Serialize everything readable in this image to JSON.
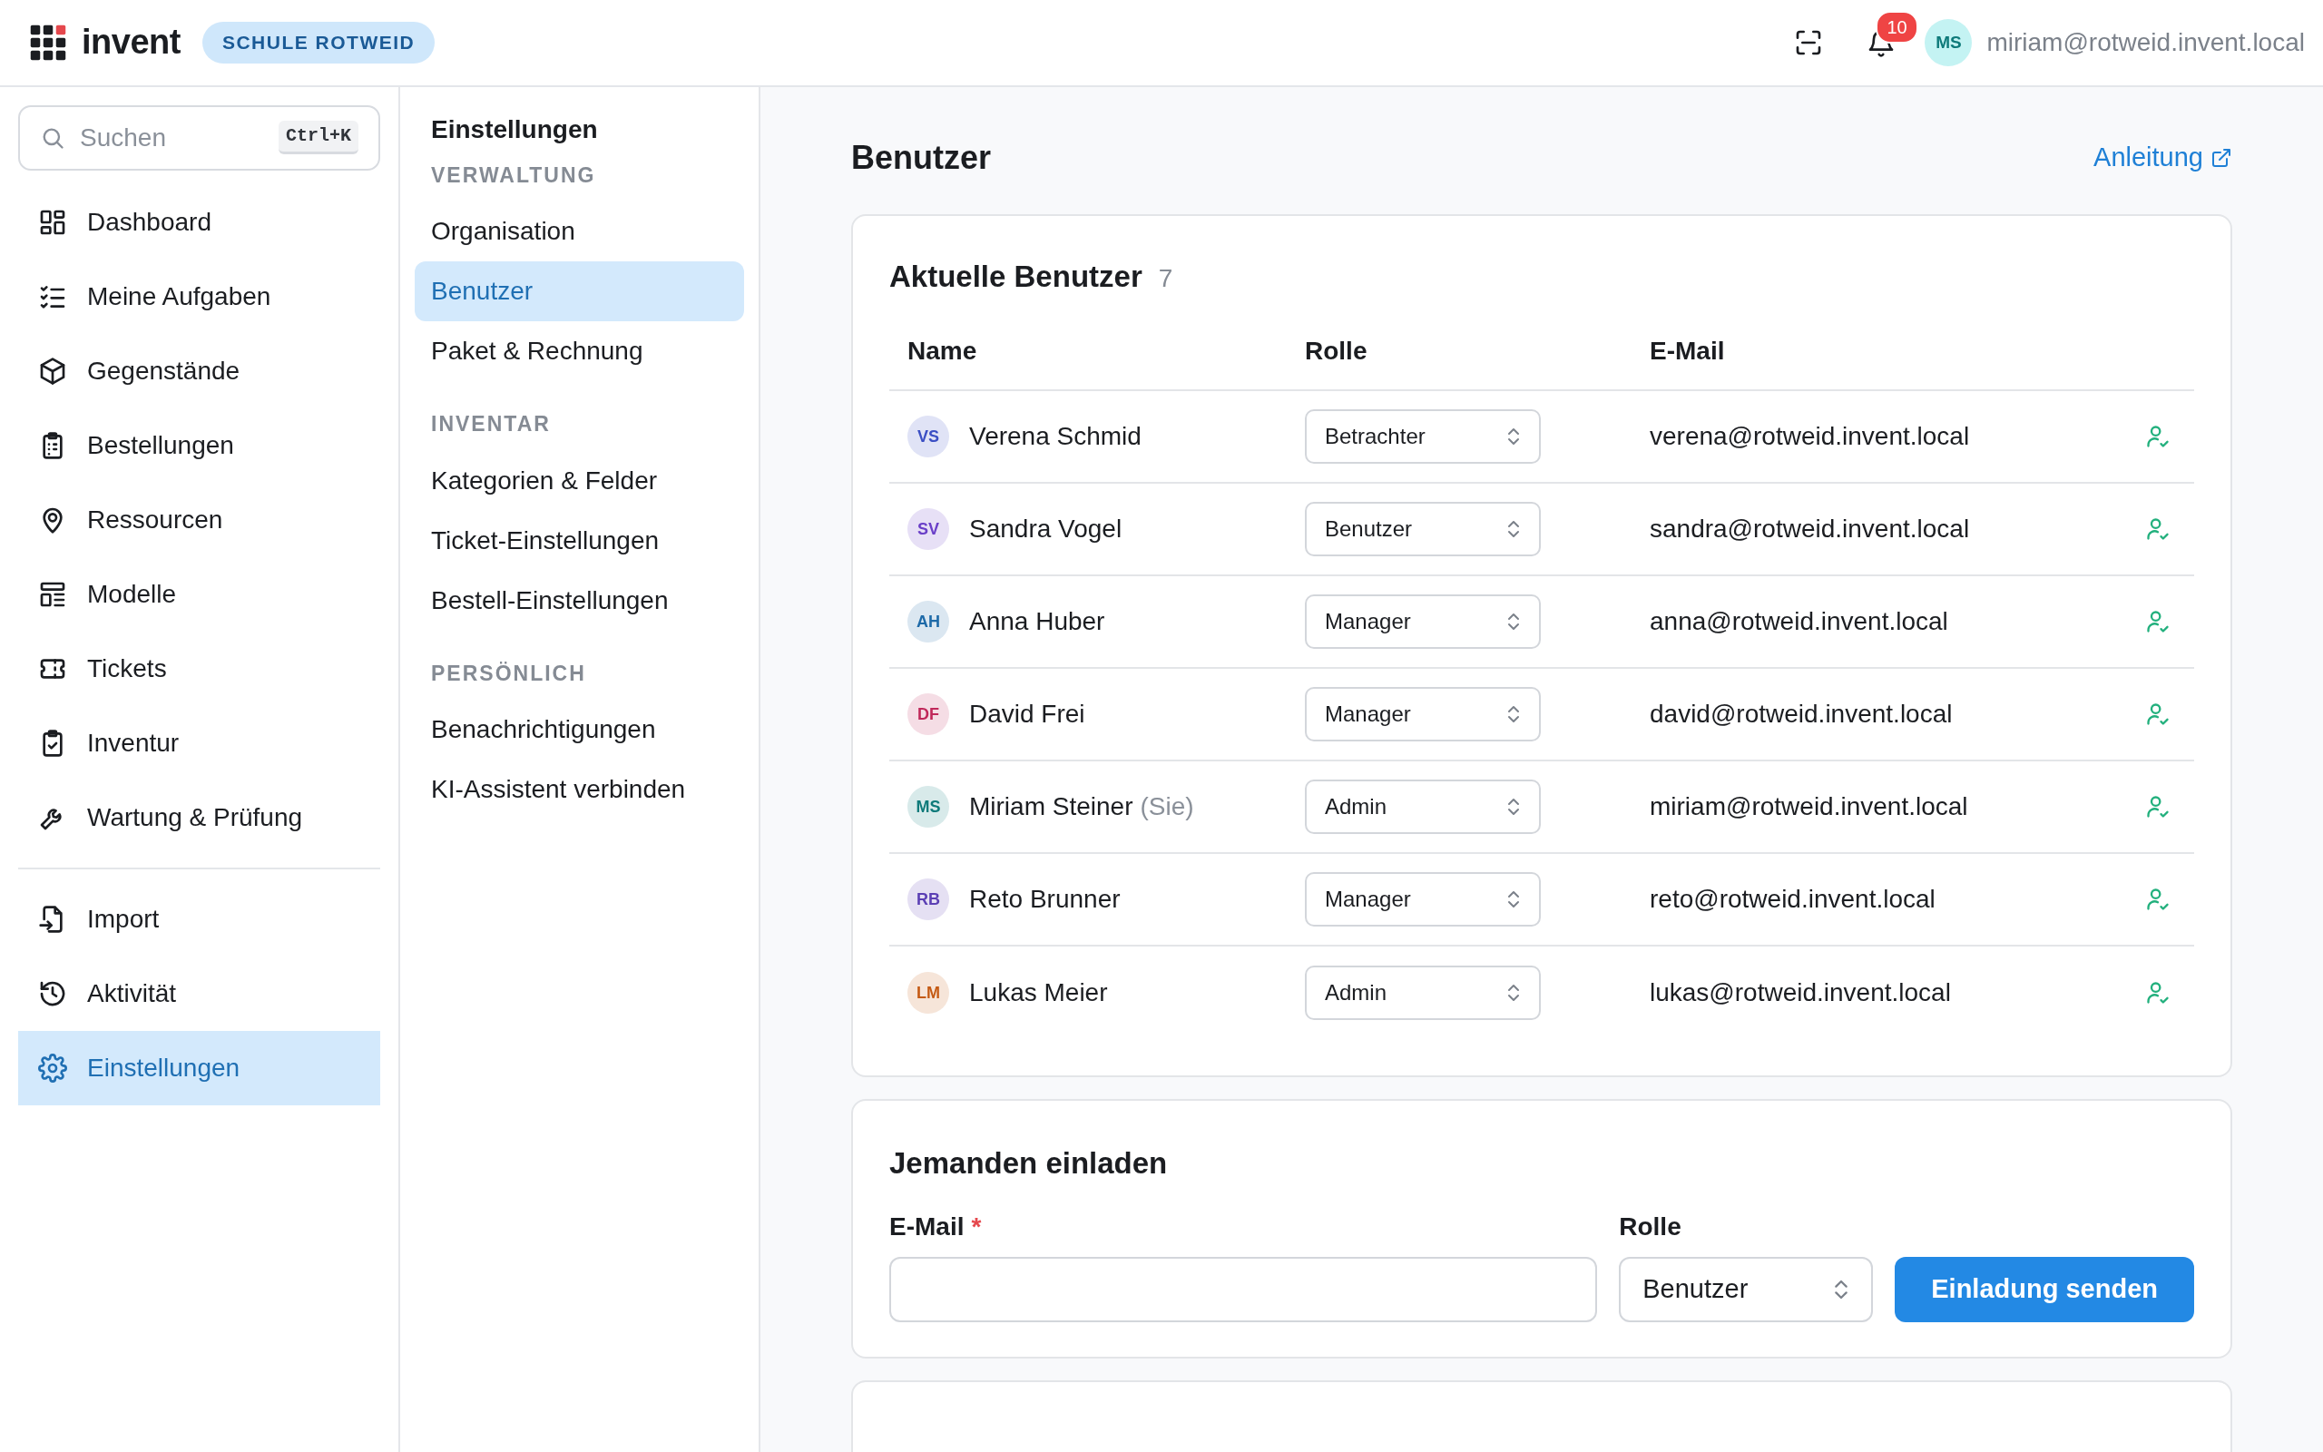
{
  "topbar": {
    "brand": "invent",
    "org_badge": "SCHULE ROTWEID",
    "notifications": "10",
    "user_initials": "MS",
    "user_email": "miriam@rotweid.invent.local"
  },
  "sidebar": {
    "search": {
      "placeholder": "Suchen",
      "shortcut": "Ctrl+K"
    },
    "items": [
      {
        "label": "Dashboard",
        "selected": false
      },
      {
        "label": "Meine Aufgaben",
        "selected": false
      },
      {
        "label": "Gegenstände",
        "selected": false
      },
      {
        "label": "Bestellungen",
        "selected": false
      },
      {
        "label": "Ressourcen",
        "selected": false
      },
      {
        "label": "Modelle",
        "selected": false
      },
      {
        "label": "Tickets",
        "selected": false
      },
      {
        "label": "Inventur",
        "selected": false
      },
      {
        "label": "Wartung & Prüfung",
        "selected": false
      }
    ],
    "bottom_items": [
      {
        "label": "Import",
        "selected": false
      },
      {
        "label": "Aktivität",
        "selected": false
      },
      {
        "label": "Einstellungen",
        "selected": true
      }
    ]
  },
  "settings_nav": {
    "title": "Einstellungen",
    "sections": [
      {
        "heading": "VERWALTUNG",
        "items": [
          {
            "label": "Organisation",
            "selected": false
          },
          {
            "label": "Benutzer",
            "selected": true
          },
          {
            "label": "Paket & Rechnung",
            "selected": false
          }
        ]
      },
      {
        "heading": "INVENTAR",
        "items": [
          {
            "label": "Kategorien & Felder",
            "selected": false
          },
          {
            "label": "Ticket-Einstellungen",
            "selected": false
          },
          {
            "label": "Bestell-Einstellungen",
            "selected": false
          }
        ]
      },
      {
        "heading": "PERSÖNLICH",
        "items": [
          {
            "label": "Benachrichtigungen",
            "selected": false
          },
          {
            "label": "KI-Assistent verbinden",
            "selected": false
          }
        ]
      }
    ]
  },
  "page": {
    "title": "Benutzer",
    "help_link": "Anleitung"
  },
  "users_card": {
    "title": "Aktuelle Benutzer",
    "count": "7",
    "columns": [
      "Name",
      "Rolle",
      "E-Mail"
    ],
    "rows": [
      {
        "initials": "VS",
        "color": "#3b4fc4",
        "name": "Verena Schmid",
        "role": "Betrachter",
        "email": "verena@rotweid.invent.local"
      },
      {
        "initials": "SV",
        "color": "#6a3fc8",
        "name": "Sandra Vogel",
        "role": "Benutzer",
        "email": "sandra@rotweid.invent.local"
      },
      {
        "initials": "AH",
        "color": "#1e6aa8",
        "name": "Anna Huber",
        "role": "Manager",
        "email": "anna@rotweid.invent.local"
      },
      {
        "initials": "DF",
        "color": "#c0285a",
        "name": "David Frei",
        "role": "Manager",
        "email": "david@rotweid.invent.local"
      },
      {
        "initials": "MS",
        "color": "#0e7a7a",
        "name": "Miriam Steiner",
        "suffix": "(Sie)",
        "role": "Admin",
        "email": "miriam@rotweid.invent.local"
      },
      {
        "initials": "RB",
        "color": "#5b3fb4",
        "name": "Reto Brunner",
        "role": "Manager",
        "email": "reto@rotweid.invent.local"
      },
      {
        "initials": "LM",
        "color": "#c45a14",
        "name": "Lukas Meier",
        "role": "Admin",
        "email": "lukas@rotweid.invent.local"
      }
    ]
  },
  "invite_card": {
    "title": "Jemanden einladen",
    "email_label": "E-Mail",
    "required_mark": "*",
    "role_label": "Rolle",
    "role_value": "Benutzer",
    "submit": "Einladung senden"
  }
}
